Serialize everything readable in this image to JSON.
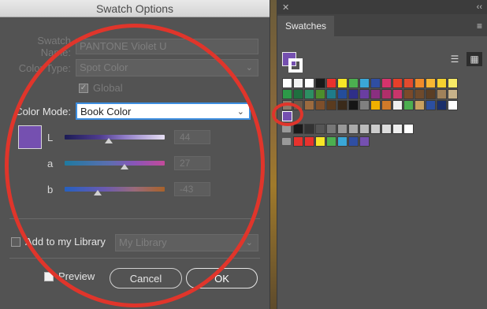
{
  "dialog": {
    "title": "Swatch Options",
    "swatch_name_label": "Swatch Name:",
    "swatch_name_value": "PANTONE Violet U",
    "color_type_label": "Color Type:",
    "color_type_value": "Spot Color",
    "global_label": "Global",
    "color_mode_label": "Color Mode:",
    "color_mode_value": "Book Color",
    "swatch_color": "#7550b0",
    "sliders": [
      {
        "label": "L",
        "value": "44",
        "pos": 0.44
      },
      {
        "label": "a",
        "value": "27",
        "pos": 0.6
      },
      {
        "label": "b",
        "value": "-43",
        "pos": 0.33
      }
    ],
    "add_library_label": "Add to my Library",
    "library_value": "My Library",
    "preview_label": "Preview",
    "cancel_label": "Cancel",
    "ok_label": "OK"
  },
  "panel": {
    "close_glyph": "✕",
    "collapse_glyph": "‹‹",
    "tab_label": "Swatches",
    "menu_glyph": "≡",
    "list_view_glyph": "☰",
    "grid_view_glyph": "▦",
    "rows": [
      [
        "#ffffff",
        "#f2f2f2",
        "#ffffff",
        "#1a1a1a",
        "#e8322d",
        "#f7e626",
        "#4caf50",
        "#3aa7d7",
        "#2f4ea2",
        "#d6336c",
        "#e63f2a",
        "#e34b2e",
        "#f08b2a",
        "#f7b733",
        "#f5d22f",
        "#f7ea66"
      ],
      [
        "#2c9a48",
        "#1f6f3f",
        "#2d8f63",
        "#4d8e2c",
        "#1f7c8a",
        "#244d9a",
        "#2f2f88",
        "#6a3ea1",
        "#8a2f80",
        "#b02f6a",
        "#c9356b",
        "#7a4a2a",
        "#6e4a2c",
        "#5a3e25",
        "#a0825a",
        "#c7b28a"
      ],
      [
        "#8b7b6b",
        "#6b5a4a",
        "#9c6b3f",
        "#7e4f2b",
        "#5a3b1f",
        "#3a2a1a",
        "#151515",
        "#808080",
        "#f0b000",
        "#d07a2a",
        "#f0f0f0",
        "#4caf50",
        "#c8a060",
        "#2c4fa0",
        "#1b2f6a",
        "#ffffff"
      ]
    ],
    "selected_swatch": "#7550b0",
    "gray_row": [
      "#1a1a1a",
      "#333333",
      "#555555",
      "#777777",
      "#999999",
      "#aaaaaa",
      "#bbbbbb",
      "#cccccc",
      "#dddddd",
      "#eeeeee",
      "#ffffff"
    ],
    "group_row": [
      "#e8322d",
      "#e8322d",
      "#f7e626",
      "#4caf50",
      "#3aa7d7",
      "#2f4ea2",
      "#7550b0"
    ]
  }
}
